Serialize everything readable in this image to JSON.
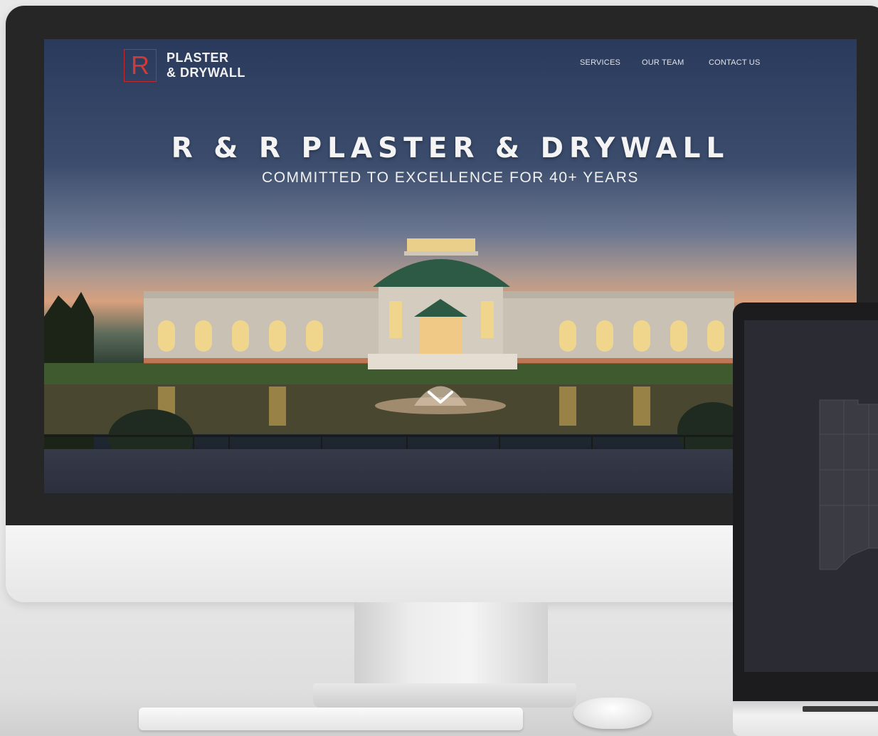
{
  "site": {
    "logo_letter": "R",
    "logo_line1": "PLASTER",
    "logo_line2": "& DRYWALL",
    "nav": [
      {
        "label": "SERVICES"
      },
      {
        "label": "OUR TEAM"
      },
      {
        "label": "CONTACT US"
      }
    ],
    "hero_title": "R & R PLASTER & DRYWALL",
    "hero_subtitle": "COMMITTED TO EXCELLENCE FOR 40+ YEARS"
  },
  "colors": {
    "brand_red": "#c3282d",
    "nav_text": "#e2e4ea",
    "hero_text": "#f4f4f4"
  },
  "icons": {
    "scroll": "chevron-down-icon"
  }
}
